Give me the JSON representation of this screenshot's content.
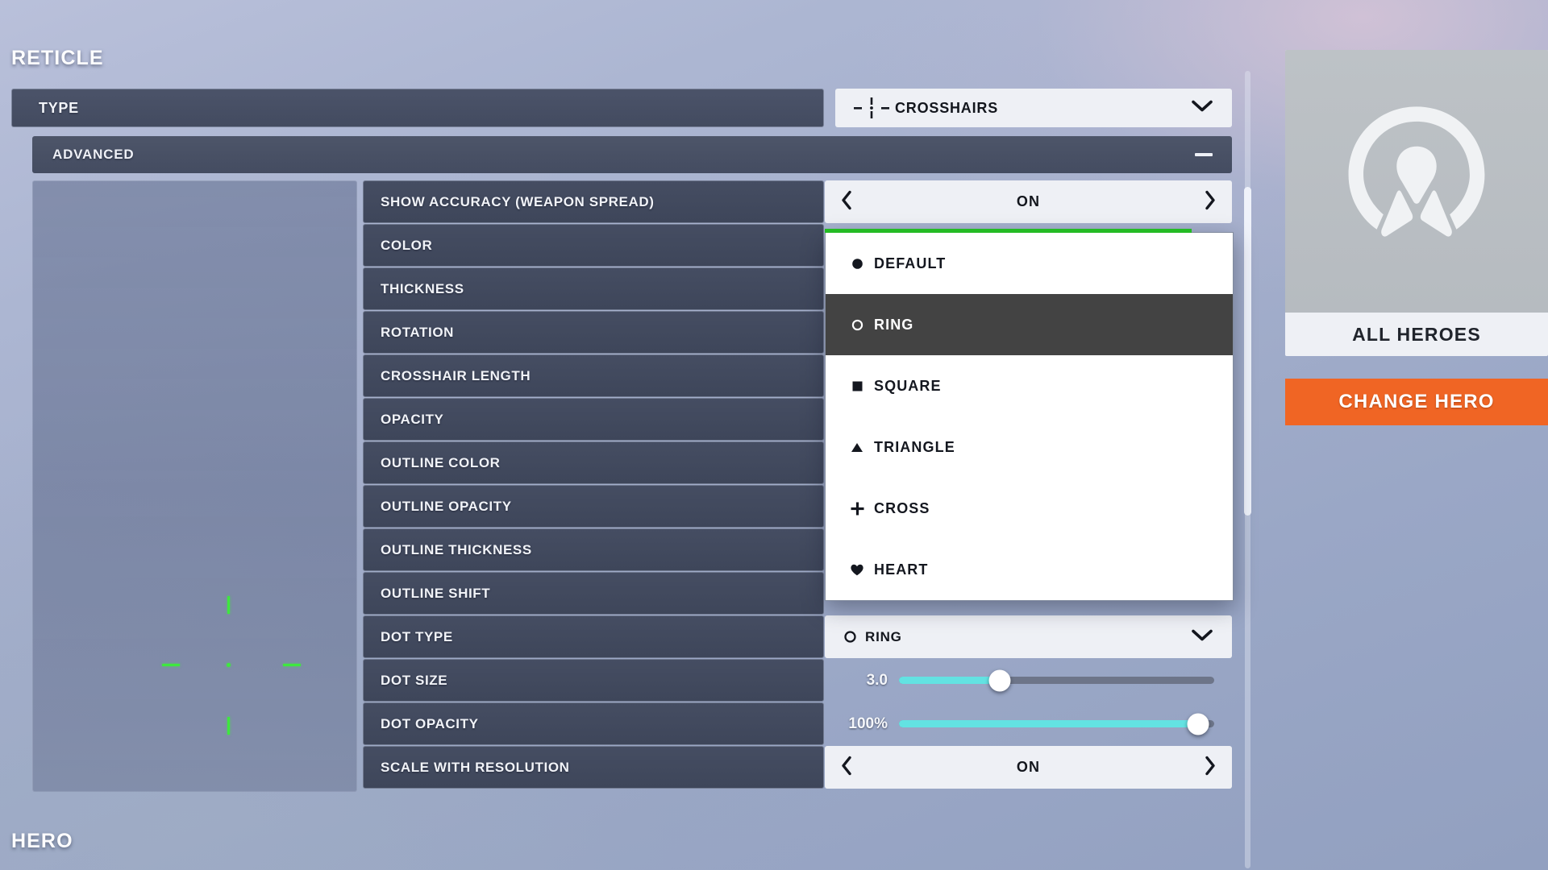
{
  "section": {
    "reticle_title": "RETICLE",
    "hero_title": "HERO"
  },
  "type_row": {
    "label": "TYPE",
    "value": "CROSSHAIRS",
    "icon": "crosshairs-icon",
    "chevron": "chevron-down-icon"
  },
  "advanced": {
    "label": "ADVANCED",
    "collapse_icon": "minus-icon"
  },
  "preview": {
    "name": "crosshair-preview",
    "color": "#3ee83e"
  },
  "settings": [
    {
      "label": "SHOW ACCURACY (WEAPON SPREAD)",
      "control": "arrows",
      "value": "ON"
    },
    {
      "label": "COLOR",
      "control": "none",
      "value": ""
    },
    {
      "label": "THICKNESS",
      "control": "none",
      "value": ""
    },
    {
      "label": "ROTATION",
      "control": "none",
      "value": ""
    },
    {
      "label": "CROSSHAIR LENGTH",
      "control": "none",
      "value": ""
    },
    {
      "label": "OPACITY",
      "control": "none",
      "value": ""
    },
    {
      "label": "OUTLINE COLOR",
      "control": "none",
      "value": ""
    },
    {
      "label": "OUTLINE OPACITY",
      "control": "none",
      "value": ""
    },
    {
      "label": "OUTLINE THICKNESS",
      "control": "none",
      "value": ""
    },
    {
      "label": "OUTLINE SHIFT",
      "control": "none",
      "value": ""
    },
    {
      "label": "DOT TYPE",
      "control": "dropdown",
      "value": "RING",
      "icon": "ring-icon"
    },
    {
      "label": "DOT SIZE",
      "control": "slider",
      "value": "3.0",
      "percent": 32
    },
    {
      "label": "DOT OPACITY",
      "control": "slider",
      "value": "100%",
      "percent": 95
    },
    {
      "label": "SCALE WITH RESOLUTION",
      "control": "arrows",
      "value": "ON"
    }
  ],
  "dropdown": {
    "accent_color": "#24bb24",
    "selected": "RING",
    "options": [
      {
        "label": "DEFAULT",
        "icon": "filled-circle-icon"
      },
      {
        "label": "RING",
        "icon": "ring-icon"
      },
      {
        "label": "SQUARE",
        "icon": "filled-square-icon"
      },
      {
        "label": "TRIANGLE",
        "icon": "filled-triangle-icon"
      },
      {
        "label": "CROSS",
        "icon": "plus-icon"
      },
      {
        "label": "HEART",
        "icon": "heart-icon"
      }
    ]
  },
  "hero_panel": {
    "portrait_icon": "overwatch-logo-icon",
    "name": "ALL HEROES",
    "change_button": "CHANGE HERO",
    "button_color": "#f06524"
  },
  "arrows": {
    "left": "chevron-left-icon",
    "right": "chevron-right-icon"
  }
}
